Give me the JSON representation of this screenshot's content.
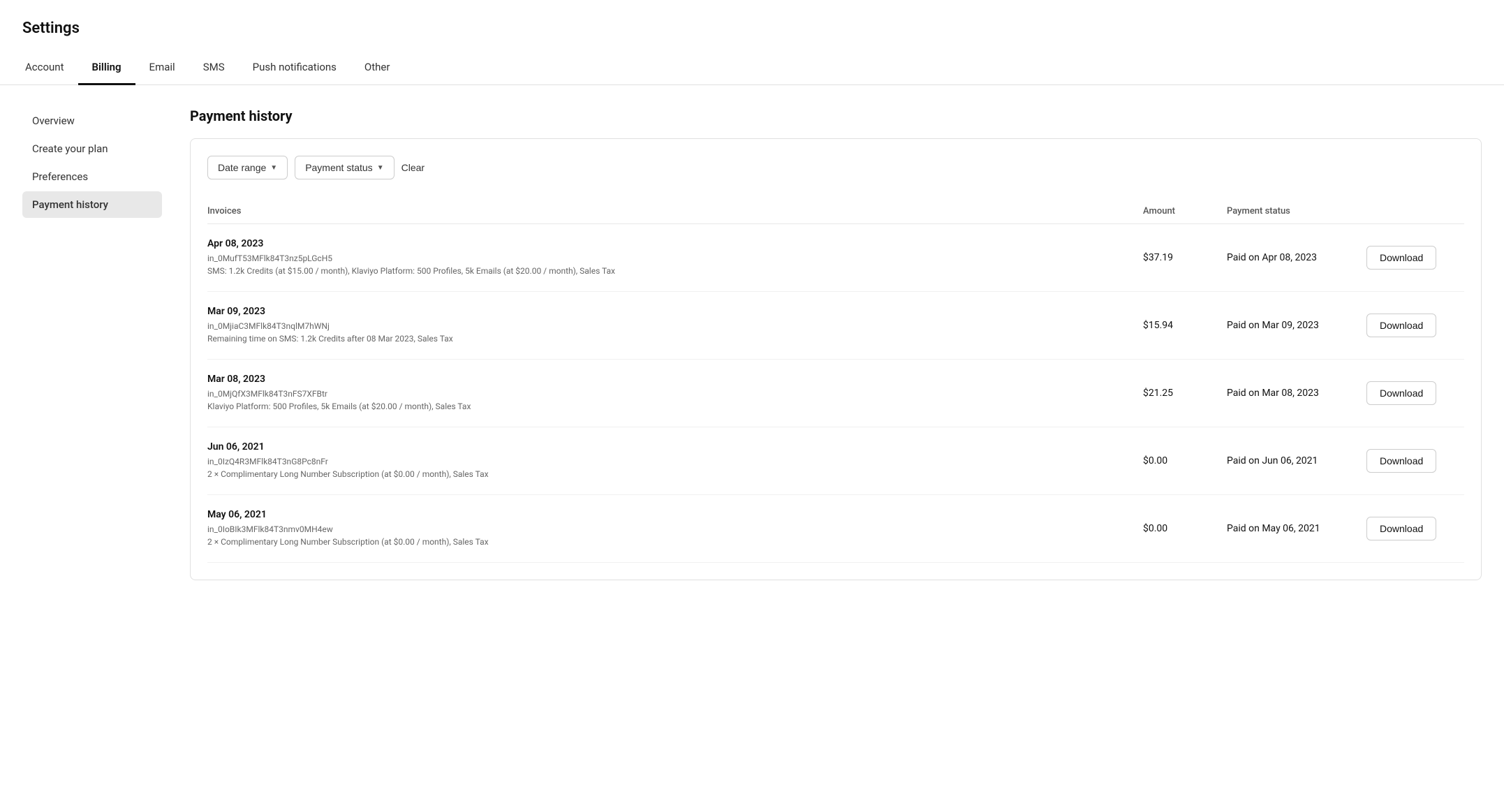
{
  "page": {
    "title": "Settings"
  },
  "nav": {
    "items": [
      {
        "id": "account",
        "label": "Account",
        "active": false
      },
      {
        "id": "billing",
        "label": "Billing",
        "active": true
      },
      {
        "id": "email",
        "label": "Email",
        "active": false
      },
      {
        "id": "sms",
        "label": "SMS",
        "active": false
      },
      {
        "id": "push-notifications",
        "label": "Push notifications",
        "active": false
      },
      {
        "id": "other",
        "label": "Other",
        "active": false
      }
    ]
  },
  "sidebar": {
    "items": [
      {
        "id": "overview",
        "label": "Overview",
        "active": false
      },
      {
        "id": "create-your-plan",
        "label": "Create your plan",
        "active": false
      },
      {
        "id": "preferences",
        "label": "Preferences",
        "active": false
      },
      {
        "id": "payment-history",
        "label": "Payment history",
        "active": true
      }
    ]
  },
  "main": {
    "section_title": "Payment history",
    "filters": {
      "date_range_label": "Date range",
      "payment_status_label": "Payment status",
      "clear_label": "Clear"
    },
    "table": {
      "columns": [
        "Invoices",
        "Amount",
        "Payment status",
        ""
      ],
      "rows": [
        {
          "date": "Apr 08, 2023",
          "invoice_id": "in_0MufT53MFlk84T3nz5pLGcH5",
          "description": "SMS: 1.2k Credits (at $15.00 / month), Klaviyo Platform: 500 Profiles, 5k Emails (at $20.00 / month), Sales Tax",
          "amount": "$37.19",
          "status": "Paid on Apr 08, 2023",
          "download_label": "Download"
        },
        {
          "date": "Mar 09, 2023",
          "invoice_id": "in_0MjiaC3MFlk84T3nqlM7hWNj",
          "description": "Remaining time on SMS: 1.2k Credits after 08 Mar 2023, Sales Tax",
          "amount": "$15.94",
          "status": "Paid on Mar 09, 2023",
          "download_label": "Download"
        },
        {
          "date": "Mar 08, 2023",
          "invoice_id": "in_0MjQfX3MFlk84T3nFS7XFBtr",
          "description": "Klaviyo Platform: 500 Profiles, 5k Emails (at $20.00 / month), Sales Tax",
          "amount": "$21.25",
          "status": "Paid on Mar 08, 2023",
          "download_label": "Download"
        },
        {
          "date": "Jun 06, 2021",
          "invoice_id": "in_0IzQ4R3MFlk84T3nG8Pc8nFr",
          "description": "2 × Complimentary Long Number Subscription (at $0.00 / month), Sales Tax",
          "amount": "$0.00",
          "status": "Paid on Jun 06, 2021",
          "download_label": "Download"
        },
        {
          "date": "May 06, 2021",
          "invoice_id": "in_0IoBIk3MFlk84T3nmv0MH4ew",
          "description": "2 × Complimentary Long Number Subscription (at $0.00 / month), Sales Tax",
          "amount": "$0.00",
          "status": "Paid on May 06, 2021",
          "download_label": "Download"
        }
      ]
    }
  }
}
